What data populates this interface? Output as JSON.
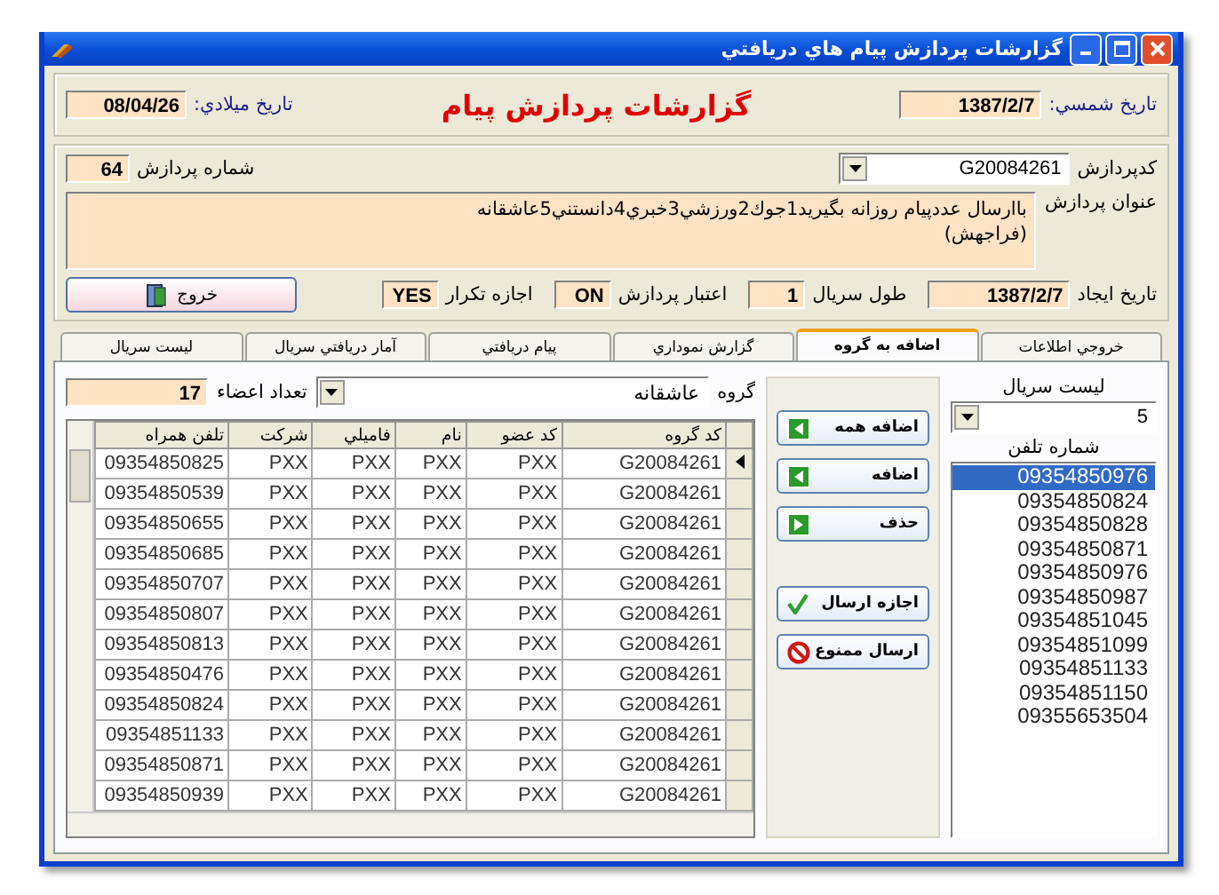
{
  "window": {
    "title": "گزارشات پردازش پيام هاي دريافتي"
  },
  "header": {
    "shamsi_label": "تاريخ شمسي:",
    "shamsi_value": "1387/2/7",
    "title": "گزارشات پردازش پيام",
    "miladi_label": "تاريخ ميلادي:",
    "miladi_value": "08/04/26"
  },
  "process": {
    "code_label": "كدپردازش",
    "code_value": "G20084261",
    "number_label": "شماره پردازش",
    "number_value": "64",
    "subject_label": "عنوان پردازش",
    "subject_value": "باارسال عددپيام روزانه بگيريد1جوك2ورزشي3خبري4دانستني5عاشقانه\n(فراجهش)",
    "creation_date": {
      "label": "تاريخ ايجاد",
      "value": "1387/2/7"
    },
    "serial_length": {
      "label": "طول سريال",
      "value": "1"
    },
    "process_validity": {
      "label": "اعتبار پردازش",
      "value": "ON"
    },
    "allow_repeat": {
      "label": "اجازه تكرار",
      "value": "YES"
    },
    "exit_button": "خروج"
  },
  "tabs": [
    {
      "label": "خروجي اطلاعات",
      "selected": false
    },
    {
      "label": "اضافه به گروه",
      "selected": true
    },
    {
      "label": "گزارش نموداري",
      "selected": false
    },
    {
      "label": "پيام دريافتي",
      "selected": false
    },
    {
      "label": "آمار دريافتي سريال",
      "selected": false
    },
    {
      "label": "ليست سريال",
      "selected": false
    }
  ],
  "serial_list": {
    "label": "ليست سريال",
    "value": "5"
  },
  "phone_list": {
    "label": "شماره تلفن",
    "items": [
      {
        "number": "09354850976",
        "selected": true
      },
      {
        "number": "09354850824",
        "selected": false
      },
      {
        "number": "09354850828",
        "selected": false
      },
      {
        "number": "09354850871",
        "selected": false
      },
      {
        "number": "09354850976",
        "selected": false
      },
      {
        "number": "09354850987",
        "selected": false
      },
      {
        "number": "09354851045",
        "selected": false
      },
      {
        "number": "09354851099",
        "selected": false
      },
      {
        "number": "09354851133",
        "selected": false
      },
      {
        "number": "09354851150",
        "selected": false
      },
      {
        "number": "09355653504",
        "selected": false
      }
    ]
  },
  "actions": [
    {
      "label": "اضافه همه",
      "kind": "add"
    },
    {
      "label": "اضافه",
      "kind": "add"
    },
    {
      "label": "حذف",
      "kind": "remove"
    },
    {
      "label": "اجازه ارسال",
      "kind": "allow"
    },
    {
      "label": "ارسال ممنوع",
      "kind": "block"
    }
  ],
  "group": {
    "label": "گروه",
    "value": "عاشقانه",
    "members_label": "تعداد اعضاء",
    "members_value": "17"
  },
  "table": {
    "columns": [
      "تلفن همراه",
      "شركت",
      "فاميلي",
      "نام",
      "كد عضو",
      "كد گروه"
    ],
    "rows": [
      {
        "selected": true,
        "cells": [
          "09354850825",
          "PXX",
          "PXX",
          "PXX",
          "PXX",
          "G20084261"
        ]
      },
      {
        "selected": false,
        "cells": [
          "09354850539",
          "PXX",
          "PXX",
          "PXX",
          "PXX",
          "G20084261"
        ]
      },
      {
        "selected": false,
        "cells": [
          "09354850655",
          "PXX",
          "PXX",
          "PXX",
          "PXX",
          "G20084261"
        ]
      },
      {
        "selected": false,
        "cells": [
          "09354850685",
          "PXX",
          "PXX",
          "PXX",
          "PXX",
          "G20084261"
        ]
      },
      {
        "selected": false,
        "cells": [
          "09354850707",
          "PXX",
          "PXX",
          "PXX",
          "PXX",
          "G20084261"
        ]
      },
      {
        "selected": false,
        "cells": [
          "09354850807",
          "PXX",
          "PXX",
          "PXX",
          "PXX",
          "G20084261"
        ]
      },
      {
        "selected": false,
        "cells": [
          "09354850813",
          "PXX",
          "PXX",
          "PXX",
          "PXX",
          "G20084261"
        ]
      },
      {
        "selected": false,
        "cells": [
          "09354850476",
          "PXX",
          "PXX",
          "PXX",
          "PXX",
          "G20084261"
        ]
      },
      {
        "selected": false,
        "cells": [
          "09354850824",
          "PXX",
          "PXX",
          "PXX",
          "PXX",
          "G20084261"
        ]
      },
      {
        "selected": false,
        "cells": [
          "09354851133",
          "PXX",
          "PXX",
          "PXX",
          "PXX",
          "G20084261"
        ]
      },
      {
        "selected": false,
        "cells": [
          "09354850871",
          "PXX",
          "PXX",
          "PXX",
          "PXX",
          "G20084261"
        ]
      },
      {
        "selected": false,
        "cells": [
          "09354850939",
          "PXX",
          "PXX",
          "PXX",
          "PXX",
          "G20084261"
        ]
      }
    ]
  }
}
